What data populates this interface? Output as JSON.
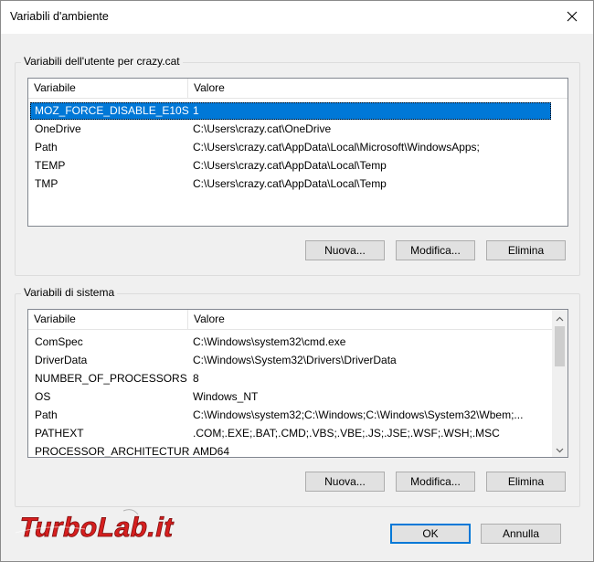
{
  "window": {
    "title": "Variabili d'ambiente",
    "close_symbol": "✕"
  },
  "user_group": {
    "label": "Variabili dell'utente per crazy.cat",
    "columns": [
      "Variabile",
      "Valore"
    ],
    "rows": [
      {
        "name": "MOZ_FORCE_DISABLE_E10S",
        "value": "1"
      },
      {
        "name": "OneDrive",
        "value": "C:\\Users\\crazy.cat\\OneDrive"
      },
      {
        "name": "Path",
        "value": "C:\\Users\\crazy.cat\\AppData\\Local\\Microsoft\\WindowsApps;"
      },
      {
        "name": "TEMP",
        "value": "C:\\Users\\crazy.cat\\AppData\\Local\\Temp"
      },
      {
        "name": "TMP",
        "value": "C:\\Users\\crazy.cat\\AppData\\Local\\Temp"
      }
    ],
    "buttons": {
      "new": "Nuova...",
      "edit": "Modifica...",
      "delete": "Elimina"
    }
  },
  "system_group": {
    "label": "Variabili di sistema",
    "columns": [
      "Variabile",
      "Valore"
    ],
    "rows": [
      {
        "name": "ComSpec",
        "value": "C:\\Windows\\system32\\cmd.exe"
      },
      {
        "name": "DriverData",
        "value": "C:\\Windows\\System32\\Drivers\\DriverData"
      },
      {
        "name": "NUMBER_OF_PROCESSORS",
        "value": "8"
      },
      {
        "name": "OS",
        "value": "Windows_NT"
      },
      {
        "name": "Path",
        "value": "C:\\Windows\\system32;C:\\Windows;C:\\Windows\\System32\\Wbem;..."
      },
      {
        "name": "PATHEXT",
        "value": ".COM;.EXE;.BAT;.CMD;.VBS;.VBE;.JS;.JSE;.WSF;.WSH;.MSC"
      },
      {
        "name": "PROCESSOR_ARCHITECTURE",
        "value": "AMD64"
      }
    ],
    "buttons": {
      "new": "Nuova...",
      "edit": "Modifica...",
      "delete": "Elimina"
    }
  },
  "footer": {
    "ok": "OK",
    "cancel": "Annulla"
  },
  "watermark": {
    "text": "TurboLab.it"
  },
  "colors": {
    "selection": "#0078d7",
    "dialog_bg": "#f0f0f0",
    "watermark_red": "#d61f1f"
  }
}
